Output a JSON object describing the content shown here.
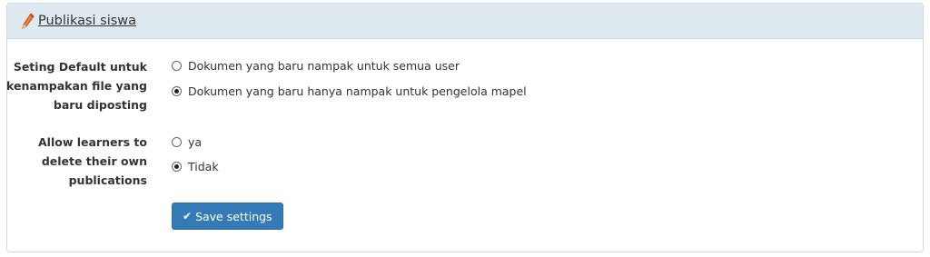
{
  "header": {
    "title": "Publikasi siswa",
    "icon": "pencil-icon"
  },
  "settings": [
    {
      "label_lines": [
        "Seting Default untuk",
        "kenampakan file yang",
        "baru diposting"
      ],
      "options": [
        {
          "label": "Dokumen yang baru nampak untuk semua user",
          "checked": false
        },
        {
          "label": "Dokumen yang baru hanya nampak untuk pengelola mapel",
          "checked": true
        }
      ]
    },
    {
      "label_lines": [
        "Allow learners to",
        "delete their own",
        "publications"
      ],
      "options": [
        {
          "label": "ya",
          "checked": false
        },
        {
          "label": "Tidak",
          "checked": true
        }
      ]
    }
  ],
  "actions": {
    "save_label": "Save settings",
    "save_icon": "check-icon"
  },
  "colors": {
    "header_bg": "#dfeaf0",
    "primary": "#337ab7"
  }
}
